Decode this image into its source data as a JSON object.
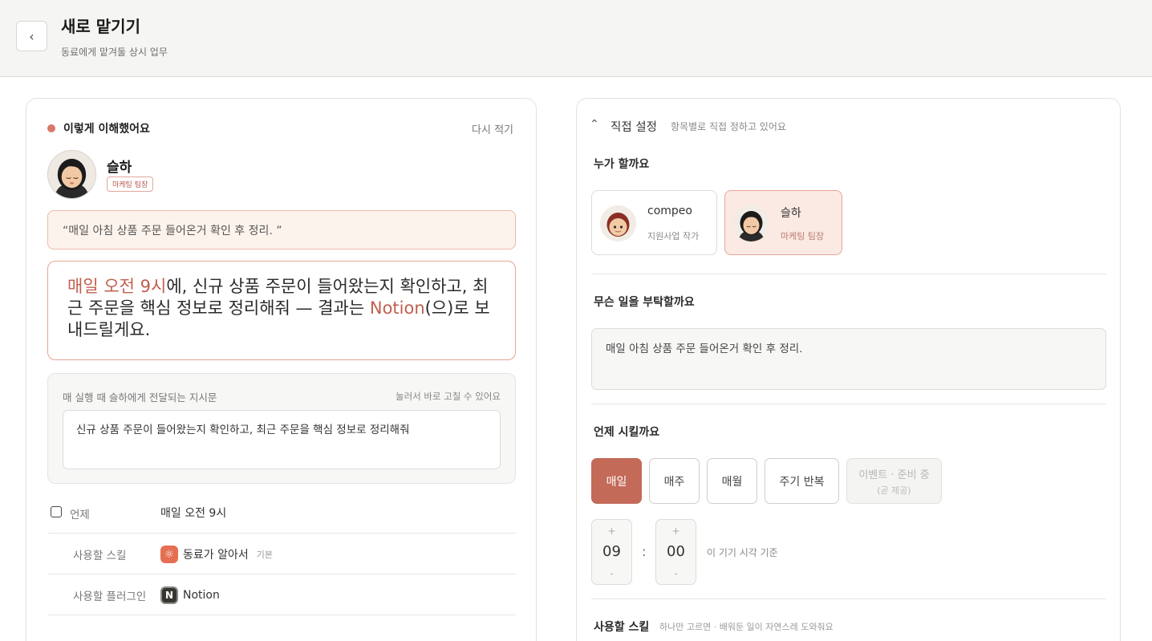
{
  "header": {
    "back_icon": "chevron-left-icon",
    "back_glyph": "‹",
    "title": "새로 맡기기",
    "subtitle": "동료에게 맡겨둘 상시 업무"
  },
  "understood": {
    "title": "이렇게 이해했어요",
    "rewrite_label": "다시 적기",
    "dot_color": "#d9796a",
    "person": {
      "name": "슬하",
      "role": "마케팅 팀장"
    },
    "quote": "“매일 아침 상품 주문 들어온거 확인 후 정리. ”",
    "summary": {
      "when": "매일 오전 9시",
      "part1": "에, 신규 상품 주문이 들어왔는지 확인하고, 최근 주문을 핵심 정보로 정리해줘 — 결과는 ",
      "destination": "Notion",
      "part2": "(으)로 보내드릴게요."
    },
    "instruction": {
      "label": "매 실행 때 슬하에게 전달되는 지시문",
      "hint": "눌러서 바로 고칠 수 있어요",
      "text": "신규 상품 주문이 들어왔는지 확인하고, 최근 주문을 핵심 정보로 정리해줘"
    },
    "rows": [
      {
        "label": "언제",
        "value": "매일 오전 9시"
      },
      {
        "label": "사용할 스킬",
        "value": "동료가 알아서",
        "sub": "기본",
        "icon": "sun-icon"
      },
      {
        "label": "사용할 플러그인",
        "value": "Notion",
        "icon": "notion-icon"
      }
    ]
  },
  "direct": {
    "title": "직접 설정",
    "hint": "항목별로 직접 정하고 있어요",
    "who": {
      "title": "누가 할까요",
      "options": [
        {
          "name": "compeo",
          "role": "지원사업 작가",
          "selected": false
        },
        {
          "name": "슬하",
          "role": "마케팅 팀장",
          "selected": true
        }
      ]
    },
    "task": {
      "title": "무슨 일을 부탁할까요",
      "value": "매일 아침 상품 주문 들어온거 확인 후 정리."
    },
    "when": {
      "title": "언제 시킬까요",
      "options": [
        "매일",
        "매주",
        "매월",
        "주기 반복"
      ],
      "disabled_option": "이벤트 · 준비 중",
      "disabled_sub": "(곧 제공)",
      "selected": "매일",
      "hour": "09",
      "minute": "00",
      "plus": "+",
      "minus": "-",
      "colon": ":",
      "time_hint": "이 기기 시각 기준"
    },
    "next": {
      "title": "사용할 스킬",
      "hint": "하나만 고르면 · 배워둔 일이 자연스레 도와줘요"
    }
  },
  "colors": {
    "accent": "#c36a59",
    "accent_light": "#fbe9e3",
    "highlight_text": "#c0604f"
  }
}
